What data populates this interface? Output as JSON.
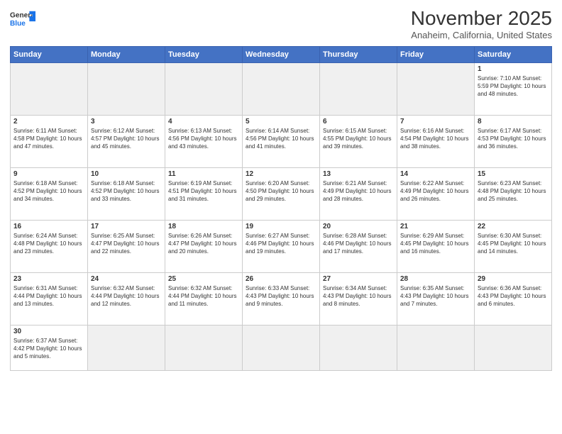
{
  "header": {
    "logo_general": "General",
    "logo_blue": "Blue",
    "title": "November 2025",
    "subtitle": "Anaheim, California, United States"
  },
  "days_of_week": [
    "Sunday",
    "Monday",
    "Tuesday",
    "Wednesday",
    "Thursday",
    "Friday",
    "Saturday"
  ],
  "weeks": [
    [
      {
        "day": "",
        "info": ""
      },
      {
        "day": "",
        "info": ""
      },
      {
        "day": "",
        "info": ""
      },
      {
        "day": "",
        "info": ""
      },
      {
        "day": "",
        "info": ""
      },
      {
        "day": "",
        "info": ""
      },
      {
        "day": "1",
        "info": "Sunrise: 7:10 AM\nSunset: 5:59 PM\nDaylight: 10 hours and 48 minutes."
      }
    ],
    [
      {
        "day": "2",
        "info": "Sunrise: 6:11 AM\nSunset: 4:58 PM\nDaylight: 10 hours and 47 minutes."
      },
      {
        "day": "3",
        "info": "Sunrise: 6:12 AM\nSunset: 4:57 PM\nDaylight: 10 hours and 45 minutes."
      },
      {
        "day": "4",
        "info": "Sunrise: 6:13 AM\nSunset: 4:56 PM\nDaylight: 10 hours and 43 minutes."
      },
      {
        "day": "5",
        "info": "Sunrise: 6:14 AM\nSunset: 4:56 PM\nDaylight: 10 hours and 41 minutes."
      },
      {
        "day": "6",
        "info": "Sunrise: 6:15 AM\nSunset: 4:55 PM\nDaylight: 10 hours and 39 minutes."
      },
      {
        "day": "7",
        "info": "Sunrise: 6:16 AM\nSunset: 4:54 PM\nDaylight: 10 hours and 38 minutes."
      },
      {
        "day": "8",
        "info": "Sunrise: 6:17 AM\nSunset: 4:53 PM\nDaylight: 10 hours and 36 minutes."
      }
    ],
    [
      {
        "day": "9",
        "info": "Sunrise: 6:18 AM\nSunset: 4:52 PM\nDaylight: 10 hours and 34 minutes."
      },
      {
        "day": "10",
        "info": "Sunrise: 6:18 AM\nSunset: 4:52 PM\nDaylight: 10 hours and 33 minutes."
      },
      {
        "day": "11",
        "info": "Sunrise: 6:19 AM\nSunset: 4:51 PM\nDaylight: 10 hours and 31 minutes."
      },
      {
        "day": "12",
        "info": "Sunrise: 6:20 AM\nSunset: 4:50 PM\nDaylight: 10 hours and 29 minutes."
      },
      {
        "day": "13",
        "info": "Sunrise: 6:21 AM\nSunset: 4:49 PM\nDaylight: 10 hours and 28 minutes."
      },
      {
        "day": "14",
        "info": "Sunrise: 6:22 AM\nSunset: 4:49 PM\nDaylight: 10 hours and 26 minutes."
      },
      {
        "day": "15",
        "info": "Sunrise: 6:23 AM\nSunset: 4:48 PM\nDaylight: 10 hours and 25 minutes."
      }
    ],
    [
      {
        "day": "16",
        "info": "Sunrise: 6:24 AM\nSunset: 4:48 PM\nDaylight: 10 hours and 23 minutes."
      },
      {
        "day": "17",
        "info": "Sunrise: 6:25 AM\nSunset: 4:47 PM\nDaylight: 10 hours and 22 minutes."
      },
      {
        "day": "18",
        "info": "Sunrise: 6:26 AM\nSunset: 4:47 PM\nDaylight: 10 hours and 20 minutes."
      },
      {
        "day": "19",
        "info": "Sunrise: 6:27 AM\nSunset: 4:46 PM\nDaylight: 10 hours and 19 minutes."
      },
      {
        "day": "20",
        "info": "Sunrise: 6:28 AM\nSunset: 4:46 PM\nDaylight: 10 hours and 17 minutes."
      },
      {
        "day": "21",
        "info": "Sunrise: 6:29 AM\nSunset: 4:45 PM\nDaylight: 10 hours and 16 minutes."
      },
      {
        "day": "22",
        "info": "Sunrise: 6:30 AM\nSunset: 4:45 PM\nDaylight: 10 hours and 14 minutes."
      }
    ],
    [
      {
        "day": "23",
        "info": "Sunrise: 6:31 AM\nSunset: 4:44 PM\nDaylight: 10 hours and 13 minutes."
      },
      {
        "day": "24",
        "info": "Sunrise: 6:32 AM\nSunset: 4:44 PM\nDaylight: 10 hours and 12 minutes."
      },
      {
        "day": "25",
        "info": "Sunrise: 6:32 AM\nSunset: 4:44 PM\nDaylight: 10 hours and 11 minutes."
      },
      {
        "day": "26",
        "info": "Sunrise: 6:33 AM\nSunset: 4:43 PM\nDaylight: 10 hours and 9 minutes."
      },
      {
        "day": "27",
        "info": "Sunrise: 6:34 AM\nSunset: 4:43 PM\nDaylight: 10 hours and 8 minutes."
      },
      {
        "day": "28",
        "info": "Sunrise: 6:35 AM\nSunset: 4:43 PM\nDaylight: 10 hours and 7 minutes."
      },
      {
        "day": "29",
        "info": "Sunrise: 6:36 AM\nSunset: 4:43 PM\nDaylight: 10 hours and 6 minutes."
      }
    ],
    [
      {
        "day": "30",
        "info": "Sunrise: 6:37 AM\nSunset: 4:42 PM\nDaylight: 10 hours and 5 minutes."
      },
      {
        "day": "",
        "info": ""
      },
      {
        "day": "",
        "info": ""
      },
      {
        "day": "",
        "info": ""
      },
      {
        "day": "",
        "info": ""
      },
      {
        "day": "",
        "info": ""
      },
      {
        "day": "",
        "info": ""
      }
    ]
  ]
}
